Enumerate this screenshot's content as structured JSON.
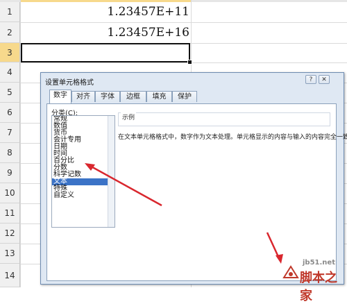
{
  "sheet": {
    "rows": [
      {
        "num": "1",
        "value": "1.23457E+11"
      },
      {
        "num": "2",
        "value": "1.23457E+16"
      },
      {
        "num": "3",
        "value": ""
      },
      {
        "num": "4",
        "value": ""
      },
      {
        "num": "5",
        "value": ""
      },
      {
        "num": "6",
        "value": ""
      },
      {
        "num": "7",
        "value": ""
      },
      {
        "num": "8",
        "value": ""
      },
      {
        "num": "9",
        "value": ""
      },
      {
        "num": "10",
        "value": ""
      },
      {
        "num": "11",
        "value": ""
      },
      {
        "num": "12",
        "value": ""
      },
      {
        "num": "13",
        "value": ""
      },
      {
        "num": "14",
        "value": ""
      }
    ],
    "selected_row": "3"
  },
  "dialog": {
    "title": "设置单元格格式",
    "help_label": "?",
    "close_label": "✕",
    "tabs": [
      "数字",
      "对齐",
      "字体",
      "边框",
      "填充",
      "保护"
    ],
    "active_tab": "数字",
    "category_label": "分类(C):",
    "categories": [
      "常规",
      "数值",
      "货币",
      "会计专用",
      "日期",
      "时间",
      "百分比",
      "分数",
      "科学记数",
      "文本",
      "特殊",
      "自定义"
    ],
    "selected_category": "文本",
    "sample_label": "示例",
    "description": "在文本单元格格式中，数字作为文本处理。单元格显示的内容与输入的内容完全一致。"
  },
  "watermark": {
    "url": "jb51.net",
    "brand": "脚本之家"
  },
  "colors": {
    "arrow": "#d9272e",
    "selection": "#3b73c7",
    "dialog_bg": "#dfe8f3"
  }
}
